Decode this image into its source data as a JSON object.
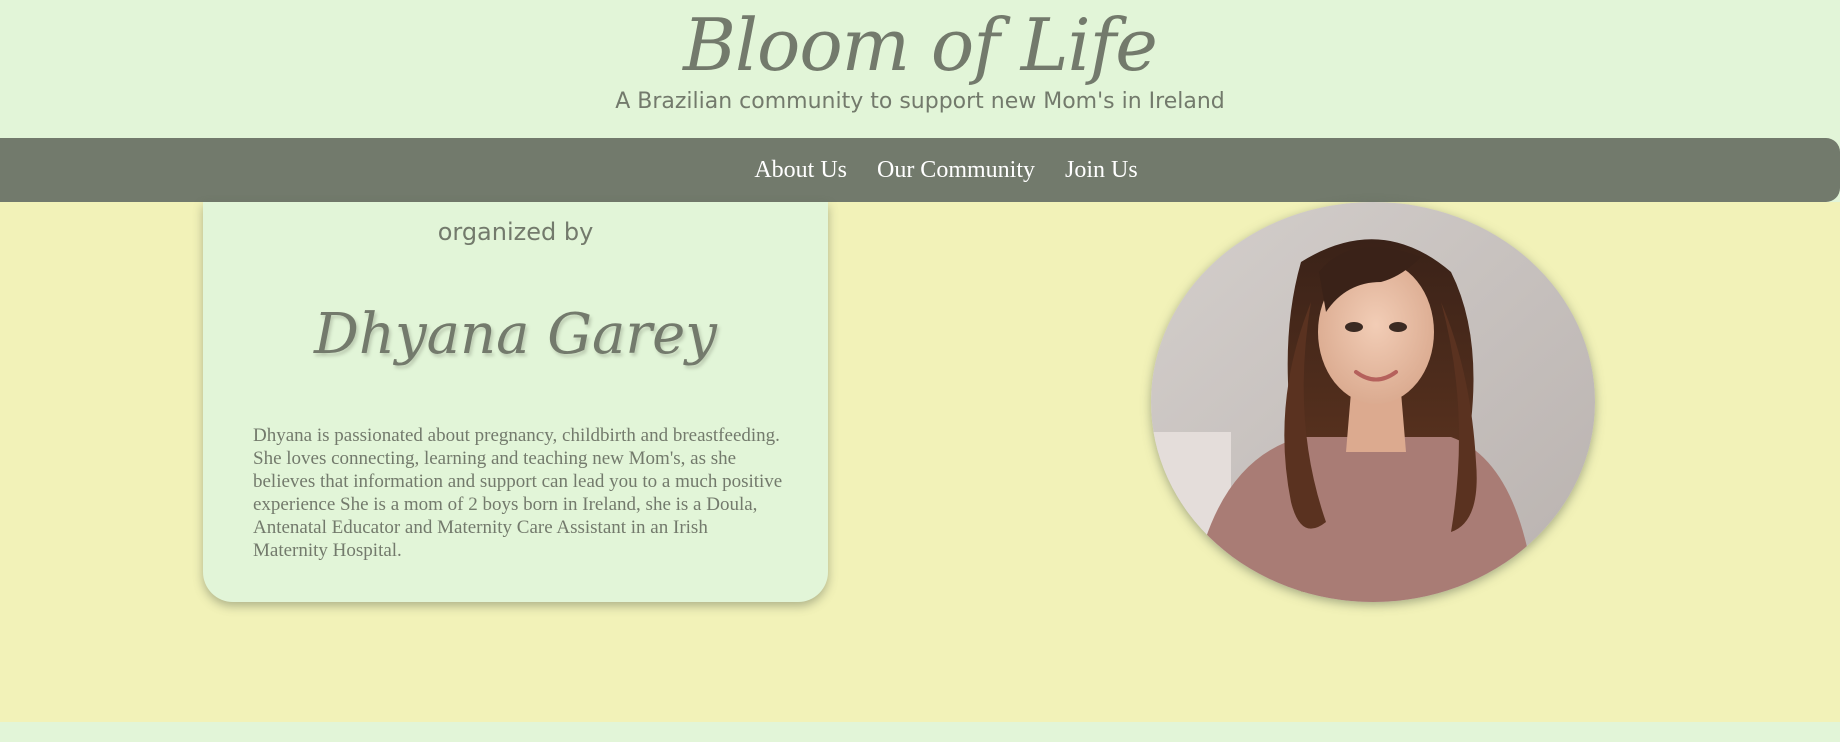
{
  "header": {
    "title": "Bloom of Life",
    "subtitle": "A Brazilian community to support new Mom's in Ireland"
  },
  "nav": {
    "items": [
      {
        "label": "About Us"
      },
      {
        "label": "Our Community"
      },
      {
        "label": "Join Us"
      }
    ]
  },
  "organizer": {
    "heading": "organized by",
    "name": "Dhyana Garey",
    "bio": "Dhyana is passionated about pregnancy, childbirth and breastfeeding. She loves connecting, learning and teaching new Mom's, as she believes that information and support can lead you to a much positive experience She is a mom of 2 boys born in Ireland, she is a Doula, Antenatal Educator and Maternity Care Assistant in an Irish Maternity Hospital."
  },
  "colors": {
    "header_bg": "#e2f5d8",
    "nav_bg": "#727a6c",
    "main_bg": "#f2f2b8",
    "text": "#737a6c"
  }
}
